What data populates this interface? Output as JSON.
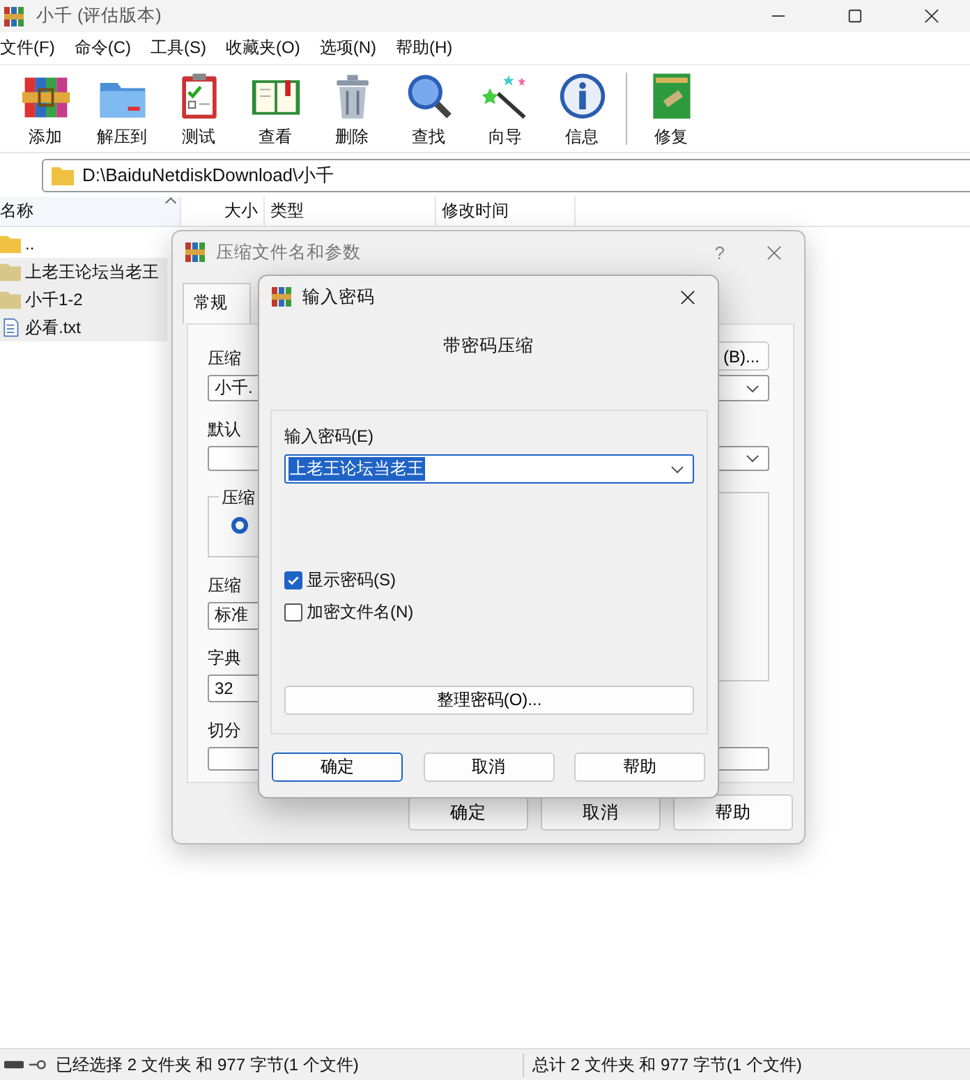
{
  "window": {
    "title": "小千 (评估版本)"
  },
  "menu": [
    "文件(F)",
    "命令(C)",
    "工具(S)",
    "收藏夹(O)",
    "选项(N)",
    "帮助(H)"
  ],
  "toolbar": [
    [
      {
        "label": "添加",
        "kind": "add"
      },
      {
        "label": "解压到",
        "kind": "extract"
      },
      {
        "label": "测试",
        "kind": "test"
      },
      {
        "label": "查看",
        "kind": "view"
      },
      {
        "label": "删除",
        "kind": "delete"
      },
      {
        "label": "查找",
        "kind": "find"
      },
      {
        "label": "向导",
        "kind": "wizard"
      },
      {
        "label": "信息",
        "kind": "info"
      }
    ],
    [
      {
        "label": "修复",
        "kind": "repair"
      }
    ]
  ],
  "address": {
    "path": "D:\\BaiduNetdiskDownload\\小千"
  },
  "columns": [
    {
      "label": "名称",
      "sorted": true
    },
    {
      "label": "大小",
      "sorted": false
    },
    {
      "label": "类型",
      "sorted": false
    },
    {
      "label": "修改时间",
      "sorted": false
    }
  ],
  "files": [
    {
      "name": "..",
      "kind": "folder",
      "selected": false
    },
    {
      "name": "上老王论坛当老王",
      "kind": "folder",
      "selected": true
    },
    {
      "name": "小千1-2",
      "kind": "folder",
      "selected": true
    },
    {
      "name": "必看.txt",
      "kind": "text",
      "selected": true
    }
  ],
  "status_bar": {
    "left": "已经选择 2 文件夹 和 977 字节(1 个文件)",
    "right": "总计 2 文件夹 和 977 字节(1 个文件)"
  },
  "options_dialog": {
    "title": "压缩文件名和参数",
    "help": "?",
    "tabs": [
      {
        "label": "常规",
        "selected": true
      }
    ],
    "archive_label": "压缩",
    "browse_button": "(B)...",
    "archive_name": "小千.",
    "profile_label": "默认",
    "format_group": "压缩",
    "format_radio_selected": true,
    "method_label": "压缩",
    "method": "标准",
    "dict_label": "字典",
    "dict": "32",
    "split_label": "切分",
    "buttons": [
      "确定",
      "取消",
      "帮助"
    ]
  },
  "password_dialog": {
    "title": "输入密码",
    "heading": "带密码压缩",
    "password_label": "输入密码(E)",
    "password": "上老王论坛当老王",
    "options": [
      {
        "label": "显示密码(S)",
        "checked": true
      },
      {
        "label": "加密文件名(N)",
        "checked": false
      }
    ],
    "organize_button": "整理密码(O)...",
    "buttons": [
      {
        "label": "确定",
        "default": true
      },
      {
        "label": "取消",
        "default": false
      },
      {
        "label": "帮助",
        "default": false
      }
    ]
  }
}
